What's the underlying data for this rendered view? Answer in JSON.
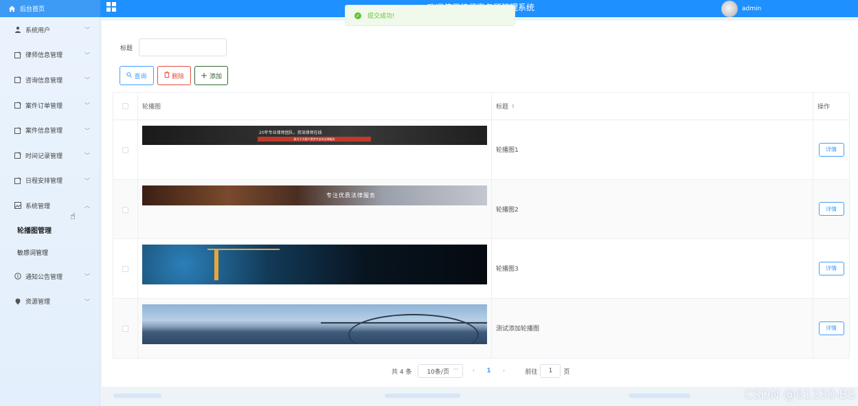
{
  "header": {
    "brand_label": "后台首页",
    "system_title": "欢迎使用律师事务所管理系统",
    "username": "admin"
  },
  "toast": {
    "message": "提交成功!"
  },
  "sidebar": {
    "items": [
      {
        "label": "系统用户",
        "icon": "user-icon"
      },
      {
        "label": "律师信息管理",
        "icon": "edit-icon"
      },
      {
        "label": "咨询信息管理",
        "icon": "edit-icon"
      },
      {
        "label": "案件订单管理",
        "icon": "edit-icon"
      },
      {
        "label": "案件信息管理",
        "icon": "edit-icon"
      },
      {
        "label": "时间记录管理",
        "icon": "edit-icon"
      },
      {
        "label": "日程安排管理",
        "icon": "edit-icon"
      },
      {
        "label": "系统管理",
        "icon": "picture-icon",
        "expanded": true
      },
      {
        "label": "通知公告管理",
        "icon": "info-icon"
      },
      {
        "label": "资源管理",
        "icon": "location-icon"
      }
    ],
    "sub_items": [
      {
        "label": "轮播图管理",
        "active": true
      },
      {
        "label": "敏感词管理",
        "active": false
      }
    ]
  },
  "search": {
    "title_label": "标题",
    "title_value": ""
  },
  "toolbar": {
    "query_label": "查询",
    "delete_label": "删除",
    "add_label": "添加"
  },
  "table": {
    "headers": {
      "image": "轮播图",
      "title": "标题",
      "action": "操作"
    },
    "rows": [
      {
        "title": "轮播图1",
        "action": "详情",
        "banner_text": "20年专业律师团队，资深律师在线",
        "banner_sub": "致力于为客户提供专业的法律服务"
      },
      {
        "title": "轮播图2",
        "action": "详情",
        "banner_text": "专注优质法律服务"
      },
      {
        "title": "轮播图3",
        "action": "详情"
      },
      {
        "title": "测试添加轮播图",
        "action": "详情"
      }
    ]
  },
  "pagination": {
    "total": "共 4 条",
    "page_size": "10条/页",
    "current_page": "1",
    "goto_label": "前往",
    "goto_value": "1",
    "page_suffix": "页"
  },
  "watermark": "CSDN @81330-BS",
  "colors": {
    "topbar": "#1e90ff",
    "primary": "#409eff",
    "danger": "#e74c3c",
    "success": "#67c23a"
  }
}
